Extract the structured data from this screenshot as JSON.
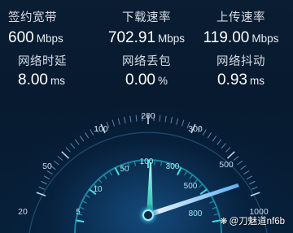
{
  "stats": [
    {
      "label": "签约宽带",
      "value": "600",
      "unit": "Mbps"
    },
    {
      "label": "下载速率",
      "value": "702.91",
      "unit": "Mbps"
    },
    {
      "label": "上传速率",
      "value": "119.00",
      "unit": "Mbps"
    },
    {
      "label": "网络时延",
      "value": "8.00",
      "unit": "ms"
    },
    {
      "label": "网络丢包",
      "value": "0.00",
      "unit": "%"
    },
    {
      "label": "网络抖动",
      "value": "0.93",
      "unit": "ms"
    }
  ],
  "gauge": {
    "outer_ticks": [
      "20",
      "50",
      "100",
      "200",
      "300",
      "500",
      "1000"
    ],
    "inner_ticks": [
      "5",
      "10",
      "50",
      "100",
      "300",
      "500",
      "800"
    ],
    "colors": {
      "accent": "#1ec8c8",
      "needle_upload": "#3fe6c8",
      "needle_download": "#8ad6ff"
    }
  },
  "watermark": {
    "text": "@刀魅道nf6b",
    "icon": "sparkle-icon"
  }
}
